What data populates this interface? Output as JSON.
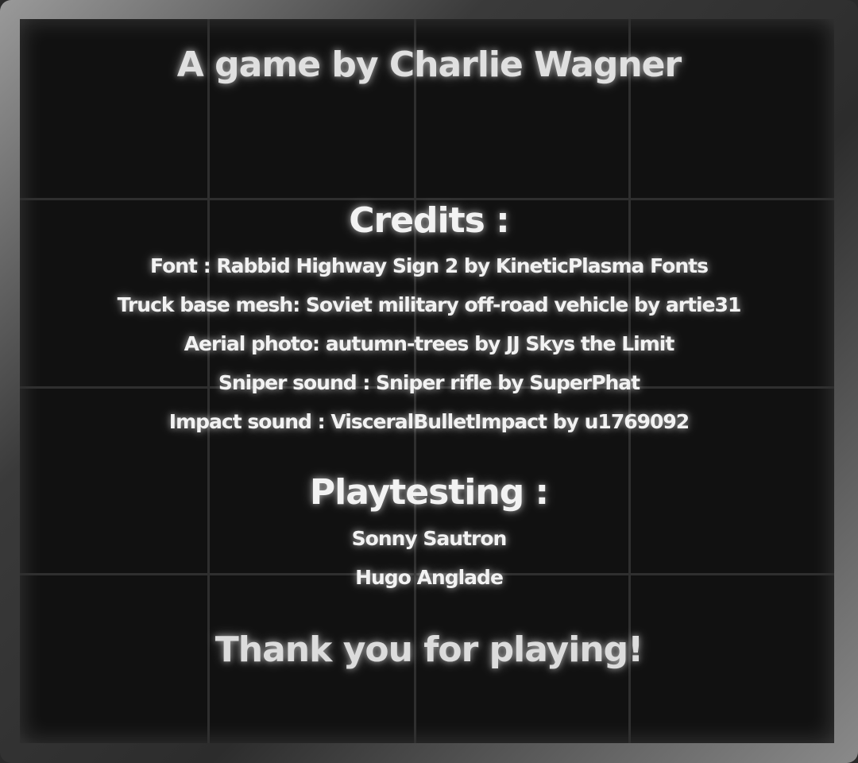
{
  "title": "A game by Charlie Wagner",
  "credits": {
    "heading": "Credits :",
    "items": [
      "Font : Rabbid Highway Sign 2 by KineticPlasma Fonts",
      "Truck base mesh: Soviet military off-road vehicle by artie31",
      "Aerial photo: autumn-trees by JJ Skys the Limit",
      "Sniper sound : Sniper rifle by SuperPhat",
      "Impact sound : VisceralBulletImpact by u1769092"
    ]
  },
  "playtesting": {
    "heading": "Playtesting :",
    "names": [
      "Sonny Sautron",
      "Hugo Anglade"
    ]
  },
  "closing": "Thank you for playing!"
}
